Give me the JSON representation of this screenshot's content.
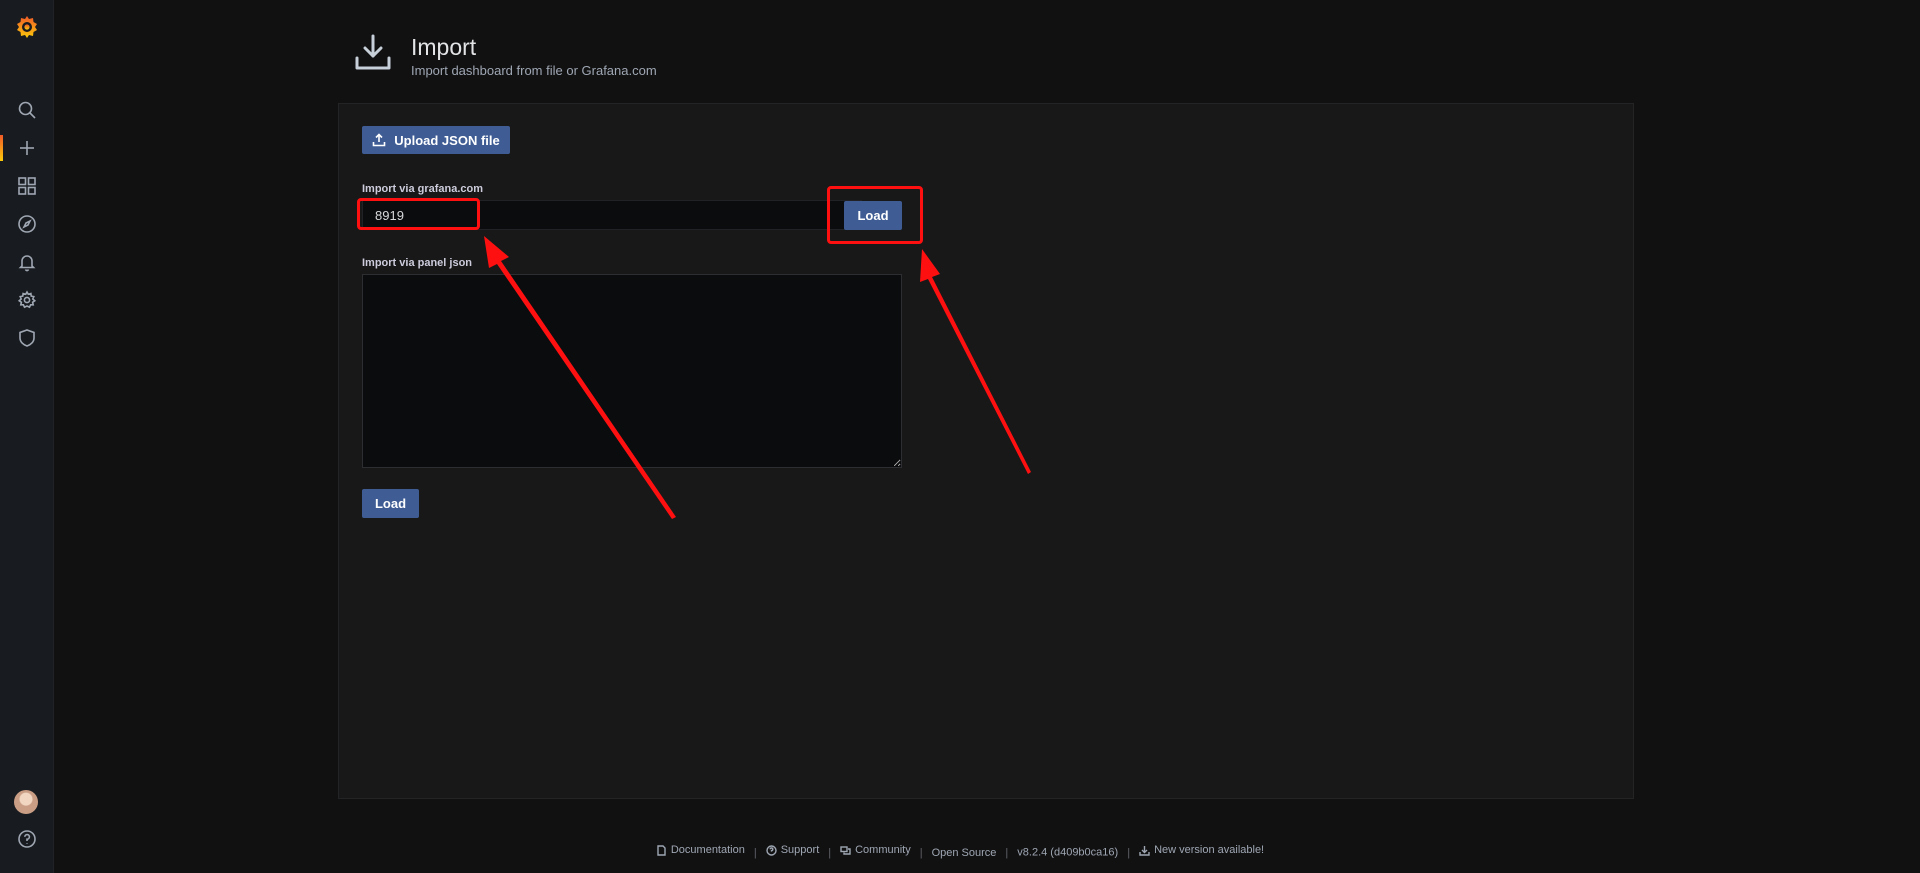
{
  "header": {
    "title": "Import",
    "subtitle": "Import dashboard from file or Grafana.com"
  },
  "upload": {
    "label": "Upload JSON file"
  },
  "grafana_com": {
    "label": "Import via grafana.com",
    "value": "8919",
    "load_label": "Load"
  },
  "panel_json": {
    "label": "Import via panel json",
    "value": "",
    "load_label": "Load"
  },
  "sidebar": {
    "items": [
      {
        "icon": "search-icon"
      },
      {
        "icon": "plus-icon",
        "active": true
      },
      {
        "icon": "dashboards-icon"
      },
      {
        "icon": "compass-icon"
      },
      {
        "icon": "bell-icon"
      },
      {
        "icon": "gear-icon"
      },
      {
        "icon": "shield-icon"
      }
    ],
    "bottom": [
      {
        "icon": "avatar"
      },
      {
        "icon": "help-icon"
      }
    ]
  },
  "footer": {
    "documentation": "Documentation",
    "support": "Support",
    "community": "Community",
    "open_source": "Open Source",
    "version": "v8.2.4 (d409b0ca16)",
    "new_version": "New version available!"
  },
  "colors": {
    "accent": "#f05a28",
    "button": "#3f5d94",
    "highlight": "#ff1010"
  }
}
